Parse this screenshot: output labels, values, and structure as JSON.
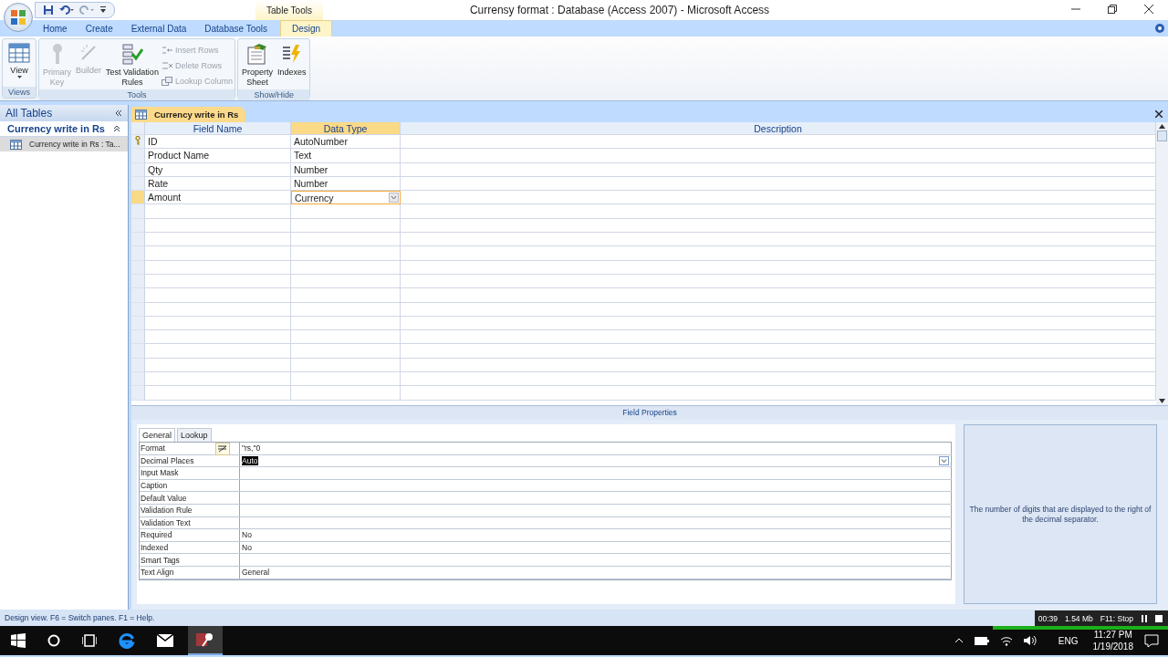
{
  "window": {
    "title": "Currensy format : Database (Access 2007) - Microsoft Access"
  },
  "contextual_tab": {
    "label": "Table Tools"
  },
  "ribbon_tabs": [
    {
      "label": "Home",
      "selected": false
    },
    {
      "label": "Create",
      "selected": false
    },
    {
      "label": "External Data",
      "selected": false
    },
    {
      "label": "Database Tools",
      "selected": false
    },
    {
      "label": "Design",
      "selected": true
    }
  ],
  "ribbon_groups": [
    {
      "label": "Views",
      "large_buttons": [
        {
          "lines": [
            "View"
          ],
          "disabled": false,
          "dropdown": true
        }
      ]
    },
    {
      "label": "Tools",
      "large_buttons": [
        {
          "lines": [
            "Primary",
            "Key"
          ],
          "disabled": true,
          "dropdown": false
        },
        {
          "lines": [
            "Builder"
          ],
          "disabled": true,
          "dropdown": false
        },
        {
          "lines": [
            "Test Validation",
            "Rules"
          ],
          "disabled": false,
          "dropdown": false
        }
      ],
      "small_buttons": [
        {
          "label": "Insert Rows",
          "disabled": true
        },
        {
          "label": "Delete Rows",
          "disabled": true
        },
        {
          "label": "Lookup Column",
          "disabled": true
        }
      ]
    },
    {
      "label": "Show/Hide",
      "large_buttons": [
        {
          "lines": [
            "Property",
            "Sheet"
          ],
          "disabled": false,
          "dropdown": false
        },
        {
          "lines": [
            "Indexes"
          ],
          "disabled": false,
          "dropdown": false
        }
      ]
    }
  ],
  "nav_pane": {
    "title": "All Tables",
    "group": "Currency write in Rs",
    "items": [
      {
        "label": "Currency write in Rs : Ta...",
        "selected": true
      }
    ]
  },
  "document_tab": {
    "label": "Currency write in Rs"
  },
  "design_grid": {
    "columns": [
      "Field Name",
      "Data Type",
      "Description"
    ],
    "rows": [
      {
        "field_name": "ID",
        "data_type": "AutoNumber",
        "primary_key": true,
        "selected": false
      },
      {
        "field_name": "Product Name",
        "data_type": "Text",
        "primary_key": false,
        "selected": false
      },
      {
        "field_name": "Qty",
        "data_type": "Number",
        "primary_key": false,
        "selected": false
      },
      {
        "field_name": "Rate",
        "data_type": "Number",
        "primary_key": false,
        "selected": false
      },
      {
        "field_name": "Amount",
        "data_type": "Currency",
        "primary_key": false,
        "selected": true
      }
    ]
  },
  "field_properties": {
    "title": "Field Properties",
    "tabs": [
      {
        "label": "General",
        "selected": true
      },
      {
        "label": "Lookup",
        "selected": false
      }
    ],
    "rows": [
      {
        "name": "Format",
        "value": "\"rs,\"0",
        "focused": false,
        "builder": true
      },
      {
        "name": "Decimal Places",
        "value": "Auto",
        "focused": true,
        "builder": false
      },
      {
        "name": "Input Mask",
        "focused": false,
        "builder": false
      },
      {
        "name": "Caption",
        "focused": false,
        "builder": false
      },
      {
        "name": "Default Value",
        "focused": false,
        "builder": false
      },
      {
        "name": "Validation Rule",
        "focused": false,
        "builder": false
      },
      {
        "name": "Validation Text",
        "focused": false,
        "builder": false
      },
      {
        "name": "Required",
        "value": "No",
        "focused": false,
        "builder": false
      },
      {
        "name": "Indexed",
        "value": "No",
        "focused": false,
        "builder": false
      },
      {
        "name": "Smart Tags",
        "focused": false,
        "builder": false
      },
      {
        "name": "Text Align",
        "value": "General",
        "focused": false,
        "builder": false
      }
    ],
    "help": "The number of digits that are displayed to the right of the decimal separator."
  },
  "status_bar": {
    "text": "Design view.  F6 = Switch panes.  F1 = Help."
  },
  "recorder": {
    "time": "00:39",
    "size": "1.54 Mb",
    "stop": "F11: Stop"
  },
  "taskbar": {
    "language": "ENG",
    "time": "11:27 PM",
    "date": "1/19/2018"
  }
}
